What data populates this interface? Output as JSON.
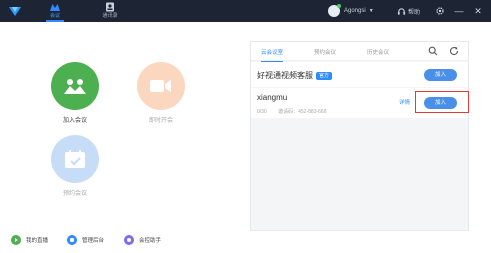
{
  "nav": {
    "items": [
      {
        "label": "会议",
        "icon": "meeting-icon",
        "active": true
      },
      {
        "label": "通讯录",
        "icon": "contacts-icon",
        "active": false
      }
    ]
  },
  "header": {
    "username": "Agongsi",
    "help_label": "帮助",
    "settings_icon": "gear-icon",
    "minimize_icon": "minimize-icon",
    "close_icon": "close-icon"
  },
  "actions": {
    "join": {
      "label": "加入会议",
      "icon": "group-icon",
      "color": "#4caf50"
    },
    "instant": {
      "label": "即时开会",
      "icon": "video-camera-icon",
      "color": "#fbd7c0"
    },
    "schedule": {
      "label": "预约会议",
      "icon": "calendar-icon",
      "color": "#c7dcf7"
    }
  },
  "shortcuts": [
    {
      "label": "我的直播",
      "icon": "play-icon",
      "color": "#4caf50"
    },
    {
      "label": "管理后台",
      "icon": "admin-icon",
      "color": "#2f8cff"
    },
    {
      "label": "会控助手",
      "icon": "assistant-icon",
      "color": "#7b6cf0"
    }
  ],
  "panel": {
    "tabs": [
      "云会议室",
      "预约会议",
      "历史会议"
    ],
    "active_tab": 0,
    "rooms": [
      {
        "name": "好视通视频客服",
        "badge": "官方",
        "join_label": "加入"
      },
      {
        "name": "xiangmu",
        "count": "0/30",
        "invite_code": "邀请码：452-883-668",
        "invite_link": "详情",
        "join_label": "加入"
      }
    ]
  },
  "colors": {
    "topbar": "#1d2433",
    "accent": "#2f8cff",
    "join_button": "#4a90e8",
    "highlight": "#e53935"
  }
}
